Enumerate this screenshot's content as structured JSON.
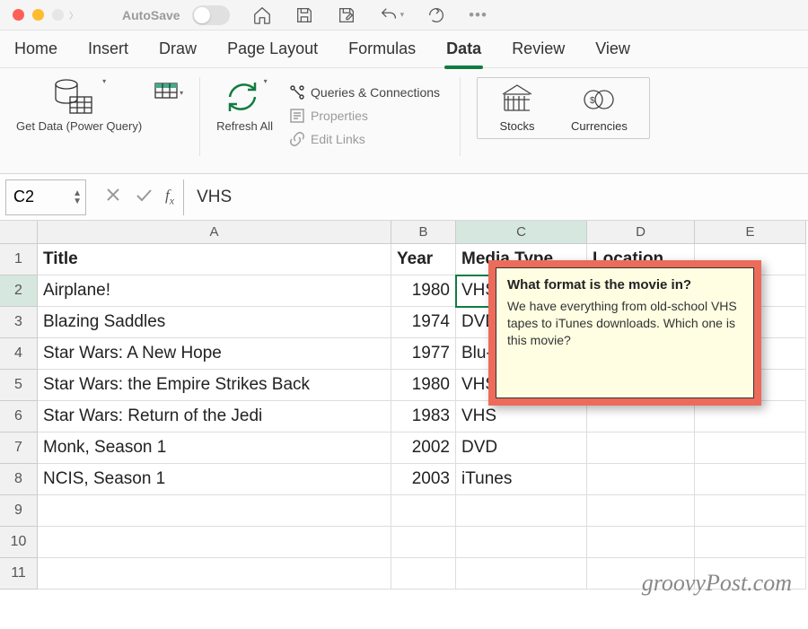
{
  "titlebar": {
    "autosave_label": "AutoSave",
    "autosave_on": false,
    "icons": [
      "home",
      "save",
      "save-draft",
      "undo",
      "redo",
      "more"
    ]
  },
  "tabs": {
    "items": [
      "Home",
      "Insert",
      "Draw",
      "Page Layout",
      "Formulas",
      "Data",
      "Review",
      "View"
    ],
    "active": "Data"
  },
  "ribbon": {
    "getdata_label": "Get Data (Power Query)",
    "refresh_label": "Refresh All",
    "queries_label": "Queries & Connections",
    "properties_label": "Properties",
    "editlinks_label": "Edit Links",
    "stocks_label": "Stocks",
    "currencies_label": "Currencies"
  },
  "formula_bar": {
    "name_box": "C2",
    "formula_value": "VHS"
  },
  "grid": {
    "columns": [
      "A",
      "B",
      "C",
      "D",
      "E"
    ],
    "row_numbers": [
      1,
      2,
      3,
      4,
      5,
      6,
      7,
      8,
      9,
      10,
      11
    ],
    "headers": {
      "A": "Title",
      "B": "Year",
      "C": "Media Type",
      "D": "Location"
    },
    "rows": [
      {
        "A": "Airplane!",
        "B": 1980,
        "C": "VHS"
      },
      {
        "A": "Blazing Saddles",
        "B": 1974,
        "C": "DVD"
      },
      {
        "A": "Star Wars: A New Hope",
        "B": 1977,
        "C": "Blu-a"
      },
      {
        "A": "Star Wars: the Empire Strikes Back",
        "B": 1980,
        "C": "VHS"
      },
      {
        "A": "Star Wars: Return of the Jedi",
        "B": 1983,
        "C": "VHS"
      },
      {
        "A": "Monk, Season 1",
        "B": 2002,
        "C": "DVD"
      },
      {
        "A": "NCIS, Season 1",
        "B": 2003,
        "C": "iTunes"
      }
    ],
    "active_cell": "C2"
  },
  "tooltip": {
    "title": "What format is the movie in?",
    "body": "We have everything from old-school VHS tapes to iTunes downloads. Which one is this movie?"
  },
  "watermark": "groovyPost.com"
}
